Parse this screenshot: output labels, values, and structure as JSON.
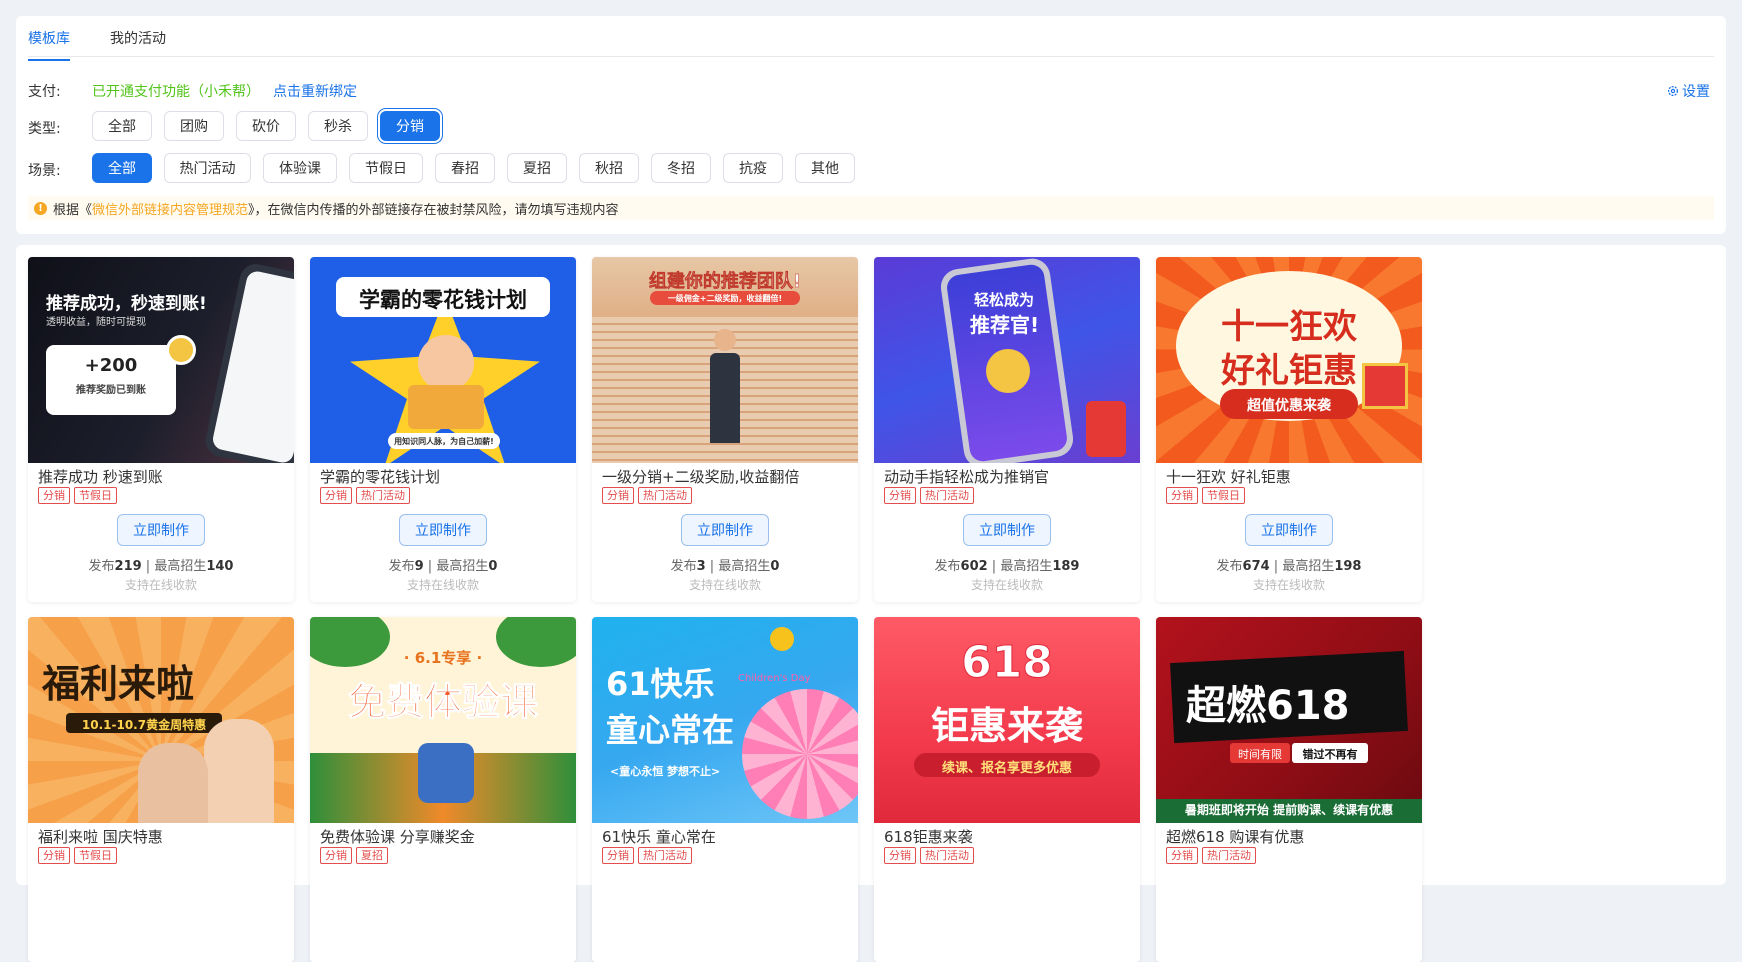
{
  "tabs": [
    {
      "label": "模板库"
    },
    {
      "label": "我的活动"
    }
  ],
  "payment": {
    "label": "支付:",
    "status": "已开通支付功能（小禾帮）",
    "rebind": "点击重新绑定"
  },
  "settings_label": "设置",
  "type_filter": {
    "label": "类型:",
    "options": [
      "全部",
      "团购",
      "砍价",
      "秒杀",
      "分销"
    ],
    "selected": "分销"
  },
  "scene_filter": {
    "label": "场景:",
    "options": [
      "全部",
      "热门活动",
      "体验课",
      "节假日",
      "春招",
      "夏招",
      "秋招",
      "冬招",
      "抗疫",
      "其他"
    ],
    "selected": "全部"
  },
  "notice": {
    "prefix": "根据《",
    "link": "微信外部链接内容管理规范",
    "suffix": "》，在微信内传播的外部链接存在被封禁风险，请勿填写违规内容"
  },
  "card_labels": {
    "make": "立即制作",
    "publish": "发布",
    "max": "最高招生",
    "online": "支持在线收款"
  },
  "templates": [
    {
      "title": "推荐成功 秒速到账",
      "tags": [
        "分销",
        "节假日"
      ],
      "published": "219",
      "max": "140",
      "art": [
        "推荐成功，秒速到账!",
        "透明收益，随时可提现",
        "+200",
        "推荐奖励已到账"
      ]
    },
    {
      "title": "学霸的零花钱计划",
      "tags": [
        "分销",
        "热门活动"
      ],
      "published": "9",
      "max": "0",
      "art": [
        "学霸的零花钱计划",
        "用知识同人脉，为自己加薪!"
      ]
    },
    {
      "title": "一级分销+二级奖励,收益翻倍",
      "tags": [
        "分销",
        "热门活动"
      ],
      "published": "3",
      "max": "0",
      "art": [
        "组建你的推荐团队!",
        "一级佣金+二级奖励，收益翻倍!"
      ]
    },
    {
      "title": "动动手指轻松成为推销官",
      "tags": [
        "分销",
        "热门活动"
      ],
      "published": "602",
      "max": "189",
      "art": [
        "轻松成为",
        "推荐官!"
      ]
    },
    {
      "title": "十一狂欢 好礼钜惠",
      "tags": [
        "分销",
        "节假日"
      ],
      "published": "674",
      "max": "198",
      "art": [
        "十一狂欢",
        "好礼钜惠",
        "超值优惠来袭"
      ]
    },
    {
      "title": "福利来啦 国庆特惠",
      "tags": [
        "分销",
        "节假日"
      ],
      "art": [
        "福利来啦",
        "10.1-10.7黄金周特惠"
      ]
    },
    {
      "title": "免费体验课 分享赚奖金",
      "tags": [
        "分销",
        "夏招"
      ],
      "art": [
        "· 6.1专享 ·",
        "免费体验课"
      ]
    },
    {
      "title": "61快乐 童心常在",
      "tags": [
        "分销",
        "热门活动"
      ],
      "art": [
        "61快乐",
        "童心常在",
        "<童心永恒 梦想不止>",
        "Children's Day"
      ]
    },
    {
      "title": "618钜惠来袭",
      "tags": [
        "分销",
        "热门活动"
      ],
      "art": [
        "618",
        "钜惠来袭",
        "续课、报名享更多优惠"
      ]
    },
    {
      "title": "超燃618 购课有优惠",
      "tags": [
        "分销",
        "热门活动"
      ],
      "art": [
        "超燃618",
        "时间有限",
        "错过不再有",
        "暑期班即将开始  提前购课、续课有优惠"
      ]
    }
  ],
  "colors": {
    "accent": "#1a73e8",
    "success": "#52c41a",
    "warning": "#f5a623",
    "tag": "#e34d4d"
  }
}
